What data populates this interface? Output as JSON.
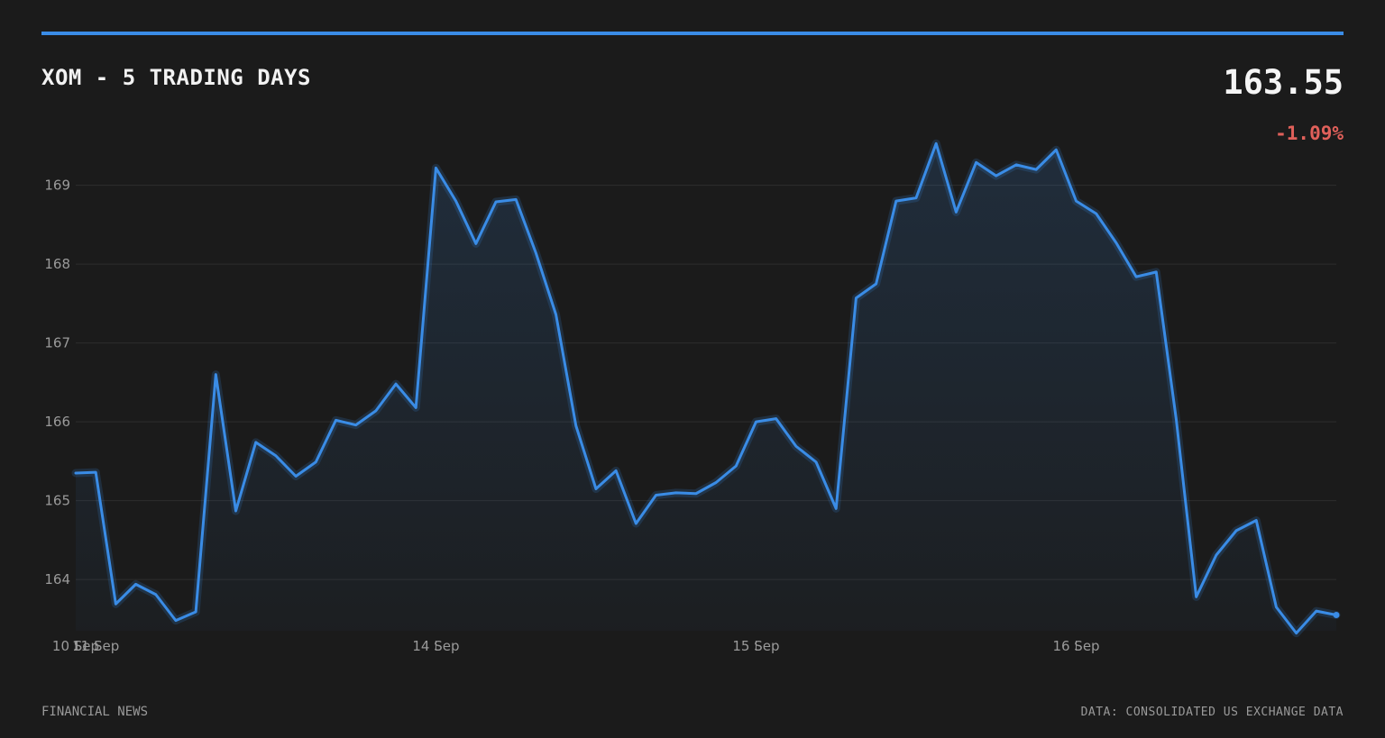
{
  "header": {
    "title": "XOM - 5 TRADING DAYS",
    "price": "163.55",
    "change": "-1.09%"
  },
  "footer": {
    "source_left": "FINANCIAL NEWS",
    "source_right": "DATA: CONSOLIDATED US EXCHANGE DATA"
  },
  "colors": {
    "background": "#1b1b1b",
    "accent": "#3a8ce6",
    "negative": "#e0605a",
    "grid": "#2e2e2e",
    "tick_text": "#9a9a9a"
  },
  "chart_data": {
    "type": "area",
    "title": "XOM - 5 TRADING DAYS",
    "xlabel": "",
    "ylabel": "",
    "ylim": [
      163.35,
      169.75
    ],
    "yticks": [
      164,
      165,
      166,
      167,
      168,
      169
    ],
    "grid": true,
    "legend": "none",
    "x_tick_labels": [
      {
        "label": "10 Sep",
        "index": 0
      },
      {
        "label": "11 Sep",
        "index": 1
      },
      {
        "label": "14 Sep",
        "index": 18
      },
      {
        "label": "15 Sep",
        "index": 34
      },
      {
        "label": "16 Sep",
        "index": 50
      }
    ],
    "series": [
      {
        "values": [
          165.35,
          165.36,
          163.69,
          163.94,
          163.81,
          163.48,
          163.59,
          166.6,
          164.87,
          165.74,
          165.57,
          165.31,
          165.49,
          166.02,
          165.96,
          166.14,
          166.48,
          166.18,
          169.22,
          168.8,
          168.26,
          168.79,
          168.82,
          168.14,
          167.36,
          165.95,
          165.15,
          165.38,
          164.71,
          165.07,
          165.1,
          165.09,
          165.23,
          165.44,
          166.0,
          166.04,
          165.69,
          165.49,
          164.9,
          167.57,
          167.75,
          168.8,
          168.84,
          169.53,
          168.66,
          169.29,
          169.12,
          169.26,
          169.2,
          169.45,
          168.8,
          168.64,
          168.27,
          167.84,
          167.9,
          166.03,
          163.78,
          164.31,
          164.62,
          164.75,
          163.65,
          163.32,
          163.6,
          163.55
        ]
      }
    ]
  }
}
